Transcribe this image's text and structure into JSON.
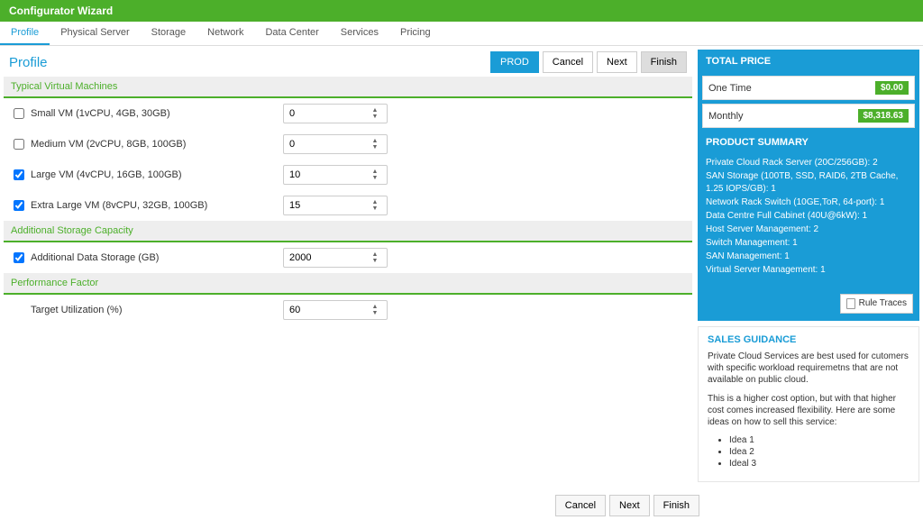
{
  "app_title": "Configurator Wizard",
  "tabs": [
    "Profile",
    "Physical Server",
    "Storage",
    "Network",
    "Data Center",
    "Services",
    "Pricing"
  ],
  "active_tab": "Profile",
  "page_title": "Profile",
  "top_buttons": {
    "prod": "PROD",
    "cancel": "Cancel",
    "next": "Next",
    "finish": "Finish"
  },
  "sections": {
    "vm": {
      "title": "Typical Virtual Machines",
      "rows": [
        {
          "label": "Small VM (1vCPU, 4GB, 30GB)",
          "checked": false,
          "value": "0"
        },
        {
          "label": "Medium VM (2vCPU, 8GB, 100GB)",
          "checked": false,
          "value": "0"
        },
        {
          "label": "Large VM (4vCPU, 16GB, 100GB)",
          "checked": true,
          "value": "10"
        },
        {
          "label": "Extra Large VM (8vCPU, 32GB, 100GB)",
          "checked": true,
          "value": "15"
        }
      ]
    },
    "storage": {
      "title": "Additional Storage Capacity",
      "rows": [
        {
          "label": "Additional Data Storage (GB)",
          "checked": true,
          "value": "2000"
        }
      ]
    },
    "perf": {
      "title": "Performance Factor",
      "rows": [
        {
          "label": "Target Utilization (%)",
          "checked": null,
          "value": "60"
        }
      ]
    }
  },
  "total_price": {
    "title": "TOTAL PRICE",
    "one_time_label": "One Time",
    "one_time_value": "$0.00",
    "monthly_label": "Monthly",
    "monthly_value": "$8,318.63"
  },
  "summary": {
    "title": "PRODUCT SUMMARY",
    "lines": [
      "Private Cloud Rack Server (20C/256GB): 2",
      "SAN Storage (100TB, SSD, RAID6, 2TB Cache, 1.25 IOPS/GB): 1",
      "Network Rack Switch (10GE,ToR, 64-port): 1",
      "Data Centre Full Cabinet (40U@6kW): 1",
      "Host Server Management: 2",
      "Switch Management: 1",
      "SAN Management: 1",
      "Virtual Server Management: 1"
    ],
    "rule_traces": "Rule Traces"
  },
  "guidance": {
    "title": "SALES GUIDANCE",
    "p1": "Private Cloud Services are best used for cutomers with specific workload requiremetns that are not available on public cloud.",
    "p2": "This is a higher cost option, but with that higher cost comes increased flexibility. Here are some ideas on how to sell this service:",
    "ideas": [
      "Idea 1",
      "Idea 2",
      "Ideal 3"
    ]
  },
  "footer": {
    "cancel": "Cancel",
    "next": "Next",
    "finish": "Finish"
  }
}
